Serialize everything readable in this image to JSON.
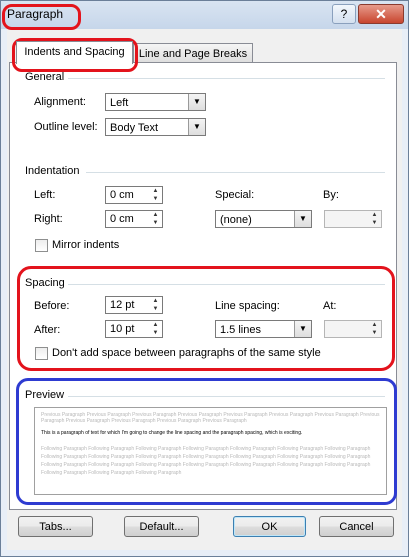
{
  "window": {
    "title": "Paragraph",
    "help_label": "?",
    "close_label": "✕"
  },
  "tabs": [
    {
      "label": "Indents and Spacing",
      "active": true
    },
    {
      "label": "Line and Page Breaks",
      "active": false
    }
  ],
  "general": {
    "title": "General",
    "alignment_label": "Alignment:",
    "alignment_value": "Left",
    "outline_label": "Outline level:",
    "outline_value": "Body Text"
  },
  "indentation": {
    "title": "Indentation",
    "left_label": "Left:",
    "left_value": "0 cm",
    "right_label": "Right:",
    "right_value": "0 cm",
    "special_label": "Special:",
    "special_value": "(none)",
    "by_label": "By:",
    "by_value": "",
    "mirror_label": "Mirror indents"
  },
  "spacing": {
    "title": "Spacing",
    "before_label": "Before:",
    "before_value": "12 pt",
    "after_label": "After:",
    "after_value": "10 pt",
    "line_spacing_label": "Line spacing:",
    "line_spacing_value": "1.5 lines",
    "at_label": "At:",
    "at_value": "",
    "dont_add_label": "Don't add space between paragraphs of the same style"
  },
  "preview": {
    "title": "Preview",
    "previous_text": "Previous Paragraph Previous Paragraph Previous Paragraph Previous Paragraph Previous Paragraph Previous Paragraph Previous Paragraph Previous Paragraph Previous Paragraph Previous Paragraph Previous Paragraph Previous Paragraph",
    "sample_text": "This is a paragraph of text for which I'm going to change the line spacing and the paragraph spacing, which is exciting.",
    "following_text": "Following Paragraph Following Paragraph Following Paragraph Following Paragraph Following Paragraph Following Paragraph Following Paragraph Following Paragraph Following Paragraph Following Paragraph Following Paragraph Following Paragraph Following Paragraph Following Paragraph Following Paragraph Following Paragraph Following Paragraph Following Paragraph Following Paragraph Following Paragraph Following Paragraph Following Paragraph Following Paragraph Following Paragraph"
  },
  "buttons": {
    "tabs": "Tabs...",
    "default": "Default...",
    "ok": "OK",
    "cancel": "Cancel"
  },
  "colors": {
    "highlight_red": "#e3131c",
    "highlight_blue": "#2e3bd1"
  }
}
